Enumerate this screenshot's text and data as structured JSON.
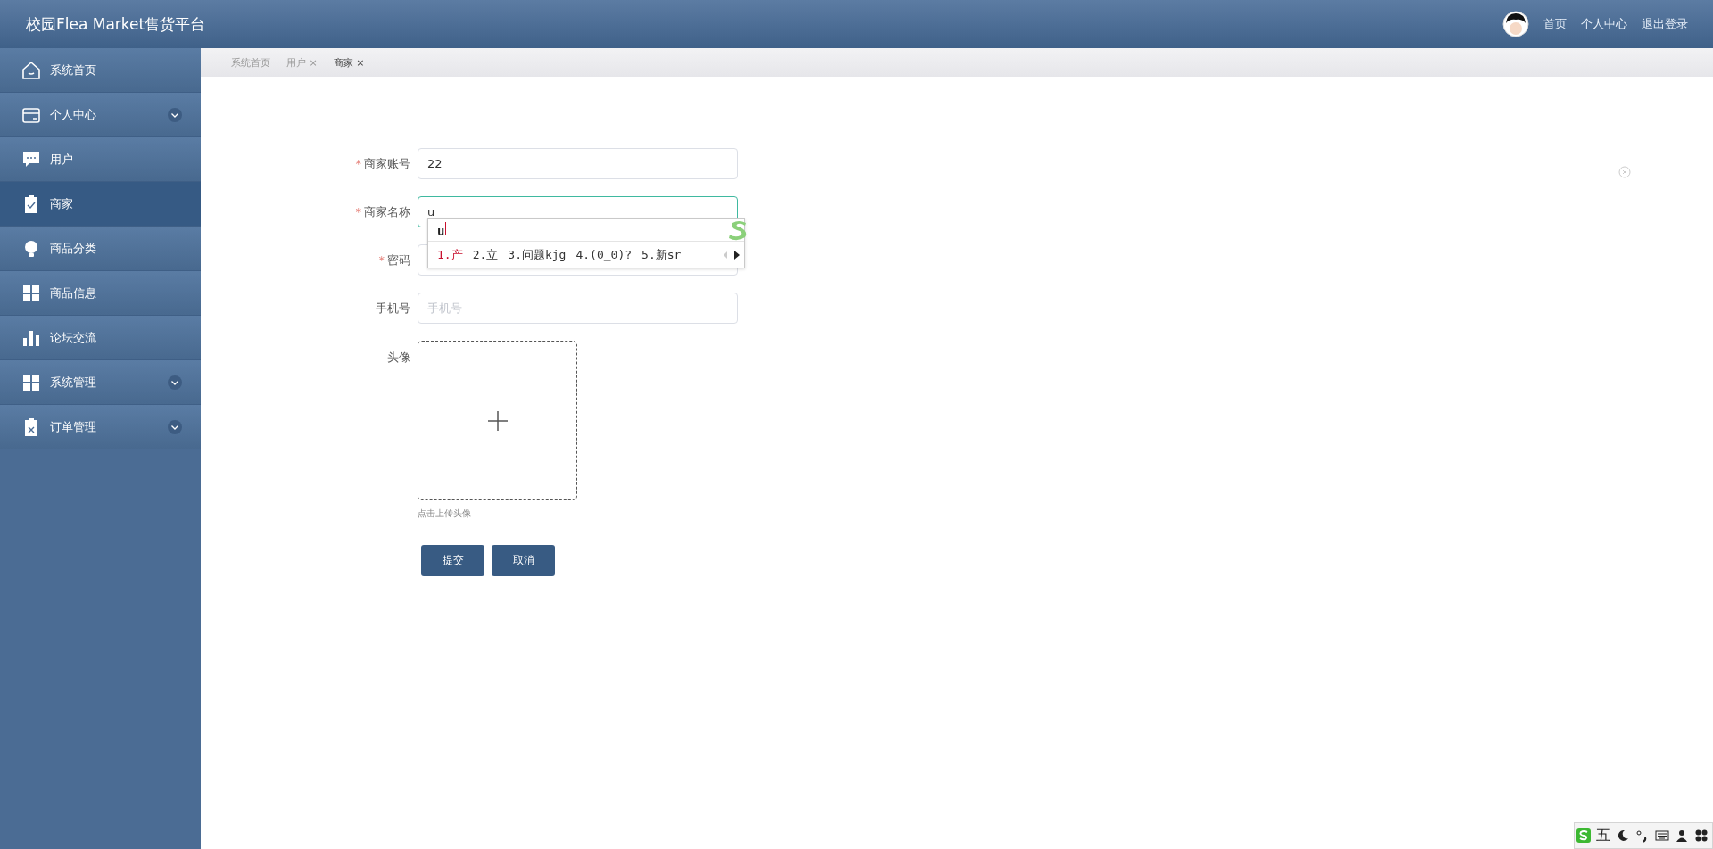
{
  "header": {
    "title": "校园Flea Market售货平台",
    "links": [
      "首页",
      "个人中心",
      "退出登录"
    ]
  },
  "sidebar": {
    "items": [
      {
        "label": "系统首页",
        "kind": "home",
        "expandable": false,
        "selected": false
      },
      {
        "label": "个人中心",
        "kind": "card",
        "expandable": true,
        "selected": false
      },
      {
        "label": "用户",
        "kind": "chat",
        "expandable": false,
        "selected": false
      },
      {
        "label": "商家",
        "kind": "clipboard-check",
        "expandable": false,
        "selected": true
      },
      {
        "label": "商品分类",
        "kind": "bulb",
        "expandable": false,
        "selected": false
      },
      {
        "label": "商品信息",
        "kind": "grid",
        "expandable": false,
        "selected": false
      },
      {
        "label": "论坛交流",
        "kind": "bars",
        "expandable": false,
        "selected": false
      },
      {
        "label": "系统管理",
        "kind": "grid",
        "expandable": true,
        "selected": false
      },
      {
        "label": "订单管理",
        "kind": "clipboard-x",
        "expandable": true,
        "selected": false
      }
    ]
  },
  "tabs": [
    {
      "label": "系统首页",
      "selected": false
    },
    {
      "label": "用户",
      "close": "×",
      "selected": false
    },
    {
      "label": "商家",
      "close": "×",
      "selected": true
    }
  ],
  "form": {
    "required_mark": "*",
    "fields": [
      {
        "label": "商家账号",
        "required": true,
        "value": "22",
        "focused": false
      },
      {
        "label": "商家名称",
        "required": true,
        "value": "u",
        "focused": true
      },
      {
        "label": "密码",
        "required": true,
        "focused": false
      },
      {
        "label": "手机号",
        "required": false,
        "placeholder": "手机号",
        "focused": false
      }
    ],
    "upload": {
      "label": "头像",
      "hint": "点击上传头像"
    },
    "buttons": [
      "提交",
      "取消"
    ]
  },
  "ime": {
    "composition": "u",
    "candidates": [
      {
        "text": "1.产",
        "selected": true
      },
      {
        "text": "2.立",
        "selected": false
      },
      {
        "text": "3.问题kjg",
        "selected": false
      },
      {
        "text": "4.(0_0)?",
        "selected": false
      },
      {
        "text": "5.新sr",
        "selected": false
      }
    ],
    "status": "五"
  }
}
